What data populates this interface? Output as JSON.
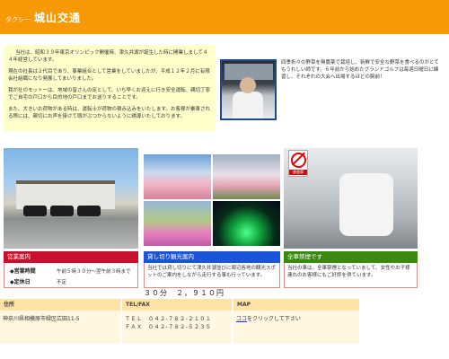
{
  "header": {
    "tag": "タクシー",
    "name": "城山交通"
  },
  "intro": {
    "p1": "当社は、昭和３９年東京オリンピック開催時、津久井湖が誕生した時に開業しまして４４年経営しています。",
    "p2": "現在の社長は２代目であり、事業組合として営業をしていましたが、平成１２年２月に有限会社組織になり発展してまいりました。",
    "p3": "我が社のモットーは、地域の皆さんの足として、いち早くお迎えに行き安全運転、親切丁寧でご自宅の戸口から目的地の戸口までお送りすることです。",
    "p4": "また、大きいお荷物がある時は、運転士が荷物の積み込みをいたします。お客様が乗車される際には、親切にお声を掛けて頭がぶつからないように誘導いたしております。"
  },
  "driver": {
    "text": "四季折々の野菜を無農薬で栽培し、新鮮で安全な野菜を食べるのがとてもうれしい師です。６年前から始めたグランドゴルフは毎週日曜日に練習し、それぞれの大会へ出場するほどの腕前！"
  },
  "sections": {
    "hours": {
      "title": "営業案内",
      "rows": [
        {
          "label": "◆営業時間",
          "value": "午前５時３０分～翌午前３時まで"
        },
        {
          "label": "◆定休日",
          "value": "不定"
        }
      ]
    },
    "tour": {
      "title": "貸し切り観光案内",
      "body": "当社では貸し切りにて津久井湖並びに周辺各地の観光スポットのご案内をしながら走行する事も行っています。",
      "price": "３０分　２，９１０円"
    },
    "smoke": {
      "title": "全車禁煙です",
      "body": "当社の車は、全車禁煙となっていまして、女性やお子様連れのお客様にもご好評を得ています。",
      "sign_label": "禁煙車"
    }
  },
  "contact": {
    "headers": {
      "address": "住所",
      "tel": "TEL/FAX",
      "map": "MAP"
    },
    "address": "神奈川県相模原市緑区広田11-5",
    "tel": "ＴＥＬ　０４２-７８２-２１０１",
    "fax": "ＦＡＸ　０４２-７８２-５２３５",
    "map_link": "ココ",
    "map_text": "をクリックして下さい"
  }
}
